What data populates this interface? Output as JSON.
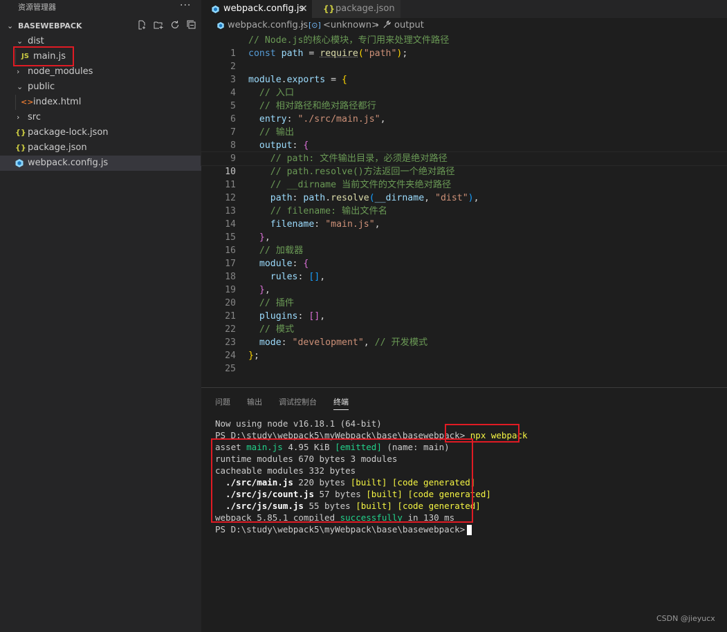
{
  "explorer": {
    "title": "资源管理器",
    "more": "···",
    "workspace": "BASEWEBPACK",
    "tree": [
      {
        "label": "dist",
        "kind": "folder",
        "expanded": true
      },
      {
        "label": "main.js",
        "kind": "js",
        "icon": "JS"
      },
      {
        "label": "node_modules",
        "kind": "folder",
        "expanded": false
      },
      {
        "label": "public",
        "kind": "folder",
        "expanded": true
      },
      {
        "label": "index.html",
        "kind": "html",
        "icon": "<>"
      },
      {
        "label": "src",
        "kind": "folder",
        "expanded": false
      },
      {
        "label": "package-lock.json",
        "kind": "json",
        "icon": "{}"
      },
      {
        "label": "package.json",
        "kind": "json",
        "icon": "{}"
      },
      {
        "label": "webpack.config.js",
        "kind": "webpack",
        "selected": true
      }
    ]
  },
  "tabs": [
    {
      "label": "webpack.config.js",
      "active": true
    },
    {
      "label": "package.json",
      "active": false
    }
  ],
  "breadcrumb": [
    "webpack.config.js",
    "<unknown>",
    "output"
  ],
  "editor": {
    "current_line": 10,
    "lines": [
      {
        "n": "1"
      },
      {
        "n": "2"
      },
      {
        "n": "3"
      },
      {
        "n": "4"
      },
      {
        "n": "5"
      },
      {
        "n": "6"
      },
      {
        "n": "7"
      },
      {
        "n": "8"
      },
      {
        "n": "9"
      },
      {
        "n": "10"
      },
      {
        "n": "11"
      },
      {
        "n": "12"
      },
      {
        "n": "13"
      },
      {
        "n": "14"
      },
      {
        "n": "15"
      },
      {
        "n": "16"
      },
      {
        "n": "17"
      },
      {
        "n": "18"
      },
      {
        "n": "19"
      },
      {
        "n": "20"
      },
      {
        "n": "21"
      },
      {
        "n": "22"
      },
      {
        "n": "23"
      },
      {
        "n": "24"
      },
      {
        "n": "25"
      }
    ],
    "text": {
      "l1": "// Node.js的核心模块，专门用来处理文件路径",
      "l2_const": "const",
      "l2_path": "path",
      "l2_eq": " = ",
      "l2_require": "require",
      "l2_arg": "\"path\"",
      "l2_end": ";",
      "l4_module": "module",
      "l4_dot": ".",
      "l4_exports": "exports",
      "l4_eq": " = ",
      "l5": "// 入口",
      "l6": "// 相对路径和绝对路径都行",
      "l7_key": "entry",
      "l7_colon": ": ",
      "l7_val": "\"./src/main.js\"",
      "l7_comma": ",",
      "l8": "// 输出",
      "l9_key": "output",
      "l9_colon": ": ",
      "l10": "// path: 文件输出目录，必须是绝对路径",
      "l11": "// path.resolve()方法返回一个绝对路径",
      "l12": "// __dirname 当前文件的文件夹绝对路径",
      "l13_key": "path",
      "l13_colon": ": ",
      "l13_obj": "path",
      "l13_dot": ".",
      "l13_fn": "resolve",
      "l13_a1": "__dirname",
      "l13_sep": ", ",
      "l13_a2": "\"dist\"",
      "l13_end": ",",
      "l14": "// filename: 输出文件名",
      "l15_key": "filename",
      "l15_colon": ": ",
      "l15_val": "\"main.js\"",
      "l15_comma": ",",
      "l16_comma": ",",
      "l17": "// 加载器",
      "l18_key": "module",
      "l18_colon": ": ",
      "l19_key": "rules",
      "l19_colon": ": ",
      "l19_comma": ",",
      "l20_comma": ",",
      "l21": "// 插件",
      "l22_key": "plugins",
      "l22_colon": ": ",
      "l22_comma": ",",
      "l23": "// 模式",
      "l24_key": "mode",
      "l24_colon": ": ",
      "l24_val": "\"development\"",
      "l24_comma": ", ",
      "l24_cm": "// 开发模式",
      "l25": ";"
    }
  },
  "panel": {
    "tabs": [
      {
        "label": "问题",
        "active": false
      },
      {
        "label": "输出",
        "active": false
      },
      {
        "label": "调试控制台",
        "active": false
      },
      {
        "label": "终端",
        "active": true
      }
    ],
    "terminal": {
      "t1": "Now using node v16.18.1 (64-bit)",
      "t2_prompt": "PS D:\\study\\webpack5\\myWebpack\\base\\basewebpack> ",
      "t2_cmd": "npx webpack",
      "t3_a": "asset ",
      "t3_file": "main.js",
      "t3_b": " 4.95 KiB ",
      "t3_emitted": "[emitted]",
      "t3_c": " (name: main)",
      "t4": "runtime modules 670 bytes 3 modules",
      "t5": "cacheable modules 332 bytes",
      "t6_file": "  ./src/main.js",
      "t6_size": " 220 bytes ",
      "t6_built": "[built]",
      "t6_sp": " ",
      "t6_gen": "[code generated]",
      "t7_file": "  ./src/js/count.js",
      "t7_size": " 57 bytes ",
      "t7_built": "[built]",
      "t7_sp": " ",
      "t7_gen": "[code generated]",
      "t8_file": "  ./src/js/sum.js",
      "t8_size": " 55 bytes ",
      "t8_built": "[built]",
      "t8_sp": " ",
      "t8_gen": "[code generated]",
      "t9_a": "webpack 5.85.1 compiled ",
      "t9_ok": "successfully",
      "t9_b": " in 130 ms",
      "t10": "PS D:\\study\\webpack5\\myWebpack\\base\\basewebpack>"
    }
  },
  "watermark": "CSDN @jieyucx",
  "colors": {
    "highlight_box": "#e01b24",
    "sidebar_bg": "#252526",
    "editor_bg": "#1e1e1e",
    "terminal_green": "#23d18b",
    "terminal_yellow": "#f5f543"
  }
}
